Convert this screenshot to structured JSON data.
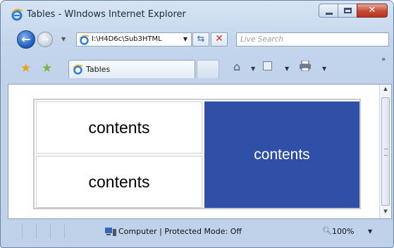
{
  "window": {
    "title": "Tables - WIndows Internet Explorer"
  },
  "navbar": {
    "address": "I:\\H4D6c\\Sub3HTML",
    "search_placeholder": "Live Search"
  },
  "tabs": [
    {
      "label": "Tables"
    }
  ],
  "page": {
    "cells": [
      "contents",
      "contents",
      "contents"
    ],
    "accent_color": "#3050a8"
  },
  "statusbar": {
    "zone": "Computer | Protected Mode: Off",
    "zoom": "100%"
  },
  "icons": [
    "ie-logo-icon",
    "minimize-icon",
    "maximize-icon",
    "close-icon",
    "back-icon",
    "forward-icon",
    "refresh-icon",
    "stop-icon",
    "favorites-star-icon",
    "add-favorite-icon",
    "home-icon",
    "feeds-icon",
    "print-icon",
    "computer-icon",
    "zoom-icon"
  ]
}
